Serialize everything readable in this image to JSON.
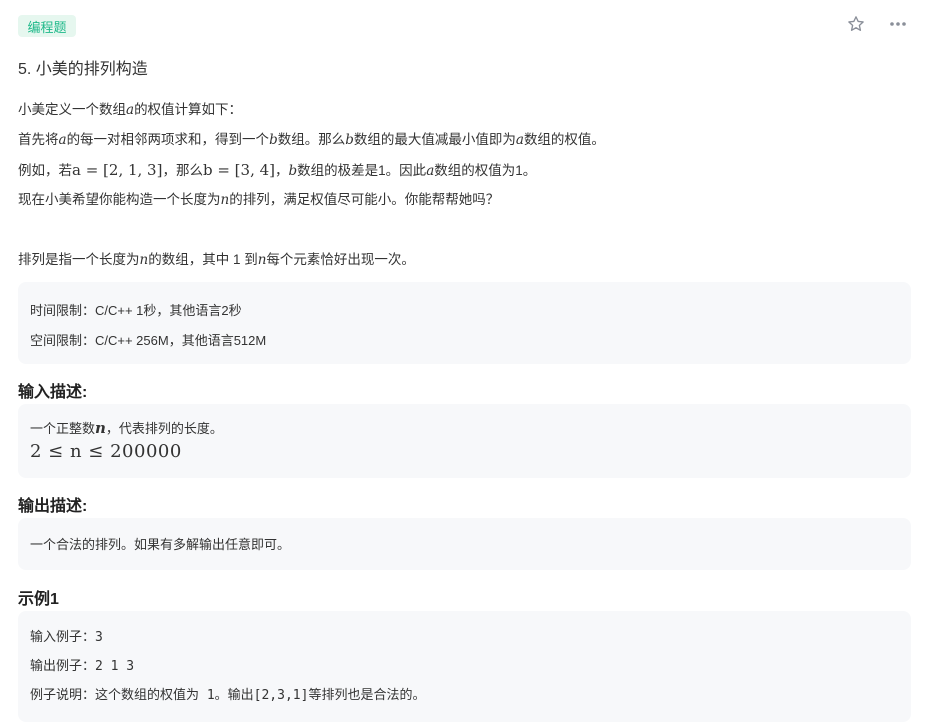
{
  "tag": {
    "label": "编程题"
  },
  "question": {
    "title": "5. 小美的排列构造"
  },
  "description": {
    "line1_a": "小美定义一个数组",
    "line1_var": "a",
    "line1_b": "的权值计算如下：",
    "line2_a": "首先将",
    "line2_var1": "a",
    "line2_b": "的每一对相邻两项求和，得到一个",
    "line2_var2": "b",
    "line2_c": "数组。那么",
    "line2_var3": "b",
    "line2_d": "数组的最大值减最小值即为",
    "line2_var4": "a",
    "line2_e": "数组的权值。",
    "line3_a": "例如，若",
    "line3_math1": "a = [2, 1, 3]",
    "line3_b": "，那么",
    "line3_math2": "b = [3, 4]",
    "line3_c": "，",
    "line3_var": "b",
    "line3_d": "数组的极差是1。因此",
    "line3_var2": "a",
    "line3_e": "数组的权值为1。",
    "line4_a": "现在小美希望你能构造一个长度为",
    "line4_var": "n",
    "line4_b": "的排列，满足权值尽可能小。你能帮帮她吗？",
    "line6_a": "排列是指一个长度为",
    "line6_var": "n",
    "line6_b": "的数组，其中 1 到",
    "line6_var2": "n",
    "line6_c": "每个元素恰好出现一次。"
  },
  "limits": {
    "time": "时间限制：C/C++ 1秒，其他语言2秒",
    "space": "空间限制：C/C++ 256M，其他语言512M"
  },
  "input_section": {
    "heading": "输入描述:",
    "text_a": "一个正整数",
    "text_var": "n",
    "text_b": "，代表排列的长度。",
    "constraint": "2 ≤ n ≤ 200000"
  },
  "output_section": {
    "heading": "输出描述:",
    "text": "一个合法的排列。如果有多解输出任意即可。"
  },
  "example": {
    "heading": "示例1",
    "input": "输入例子：3",
    "output": "输出例子：2 1 3",
    "explanation": "例子说明：这个数组的权值为 1。输出[2,3,1]等排列也是合法的。"
  },
  "icons": {
    "star": "star-icon",
    "more": "more-icon"
  }
}
